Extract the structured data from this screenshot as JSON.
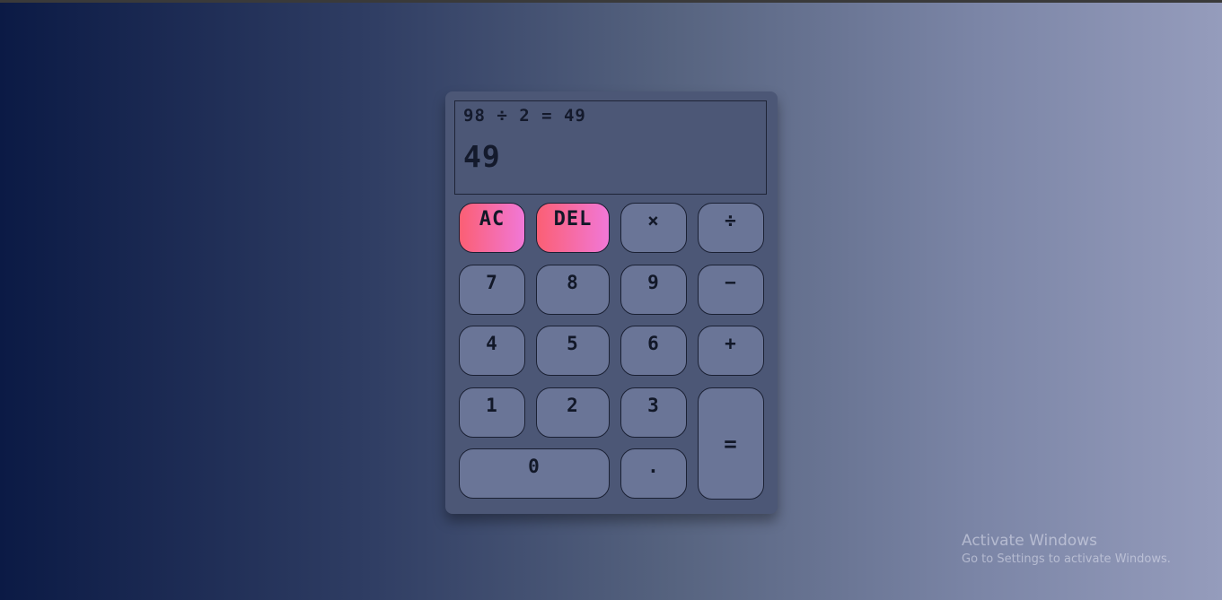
{
  "display": {
    "expression": "98 ÷ 2 = 49",
    "result": "49"
  },
  "buttons": {
    "ac": "AC",
    "del": "DEL",
    "multiply": "×",
    "divide": "÷",
    "seven": "7",
    "eight": "8",
    "nine": "9",
    "subtract": "−",
    "four": "4",
    "five": "5",
    "six": "6",
    "add": "+",
    "one": "1",
    "two": "2",
    "three": "3",
    "equals": "=",
    "zero": "0",
    "decimal": "."
  },
  "watermark": {
    "title": "Activate Windows",
    "subtitle": "Go to Settings to activate Windows."
  },
  "colors": {
    "accent_gradient_start": "#fb5f74",
    "accent_gradient_end": "#f178d7",
    "button_bg": "#6a7597",
    "panel_bg": "#4c5776"
  }
}
